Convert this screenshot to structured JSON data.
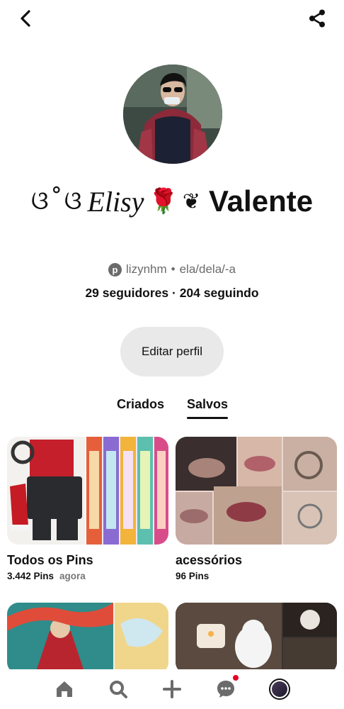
{
  "header": {
    "back_icon": "chevron-left-icon",
    "share_icon": "share-icon"
  },
  "profile": {
    "name_prefix_glyphs": "ଓ˚ଓ",
    "name_script": "Elisy",
    "name_rose": "🌹",
    "name_leaf": "❦",
    "name_main": "Valente",
    "pinterest_logo": "p",
    "handle": "lizynhm",
    "separator": "•",
    "pronouns": "ela/dela/-a",
    "followers_stats": "29 seguidores · 204 seguindo",
    "edit_label": "Editar perfil"
  },
  "tabs": [
    {
      "label": "Criados",
      "active": false
    },
    {
      "label": "Salvos",
      "active": true
    }
  ],
  "boards": [
    {
      "title": "Todos os Pins",
      "pin_count": "3.442 Pins",
      "time": "agora"
    },
    {
      "title": "acessórios",
      "pin_count": "96 Pins",
      "time": ""
    }
  ],
  "bottom_nav": [
    {
      "name": "home",
      "icon": "home-icon"
    },
    {
      "name": "search",
      "icon": "search-icon"
    },
    {
      "name": "create",
      "icon": "plus-icon"
    },
    {
      "name": "messages",
      "icon": "chat-icon",
      "has_notification": true
    },
    {
      "name": "profile",
      "icon": "avatar"
    }
  ],
  "colors": {
    "accent": "#e60023",
    "button_bg": "#e9e9e9",
    "muted": "#6b6b6b"
  }
}
